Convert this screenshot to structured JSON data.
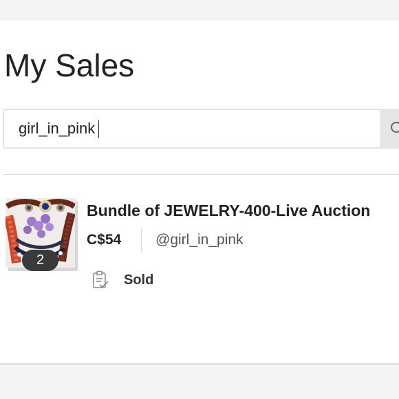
{
  "page": {
    "title": "My Sales"
  },
  "search": {
    "value": "girl_in_pink",
    "button_icon": "search-icon"
  },
  "listing": {
    "title": "Bundle of JEWELRY-400-Live Auction",
    "price": "C$54",
    "seller": "@girl_in_pink",
    "photo_count": "2",
    "status": "Sold",
    "status_icon": "clipboard-check-icon"
  }
}
